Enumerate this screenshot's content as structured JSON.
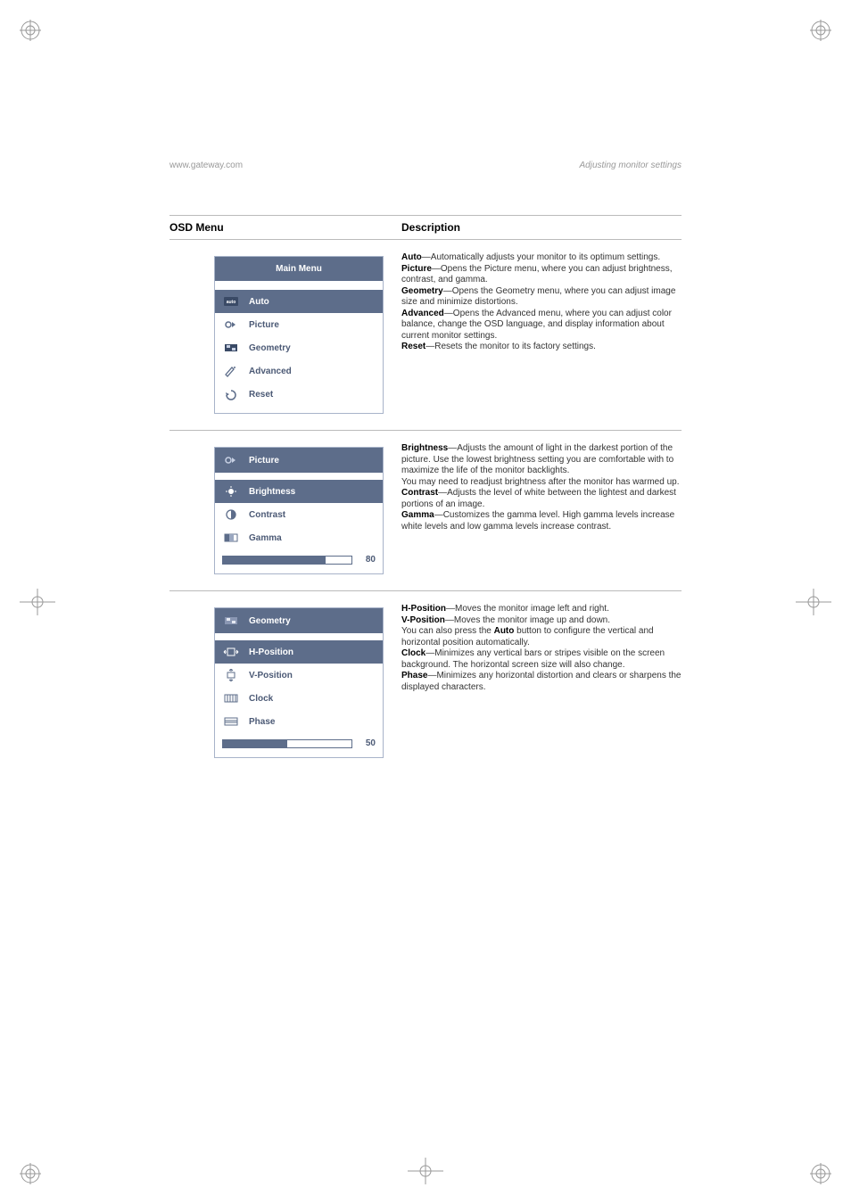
{
  "header": {
    "left": "www.gateway.com",
    "right": "Adjusting monitor settings"
  },
  "table_headers": {
    "osd": "OSD Menu",
    "desc": "Description"
  },
  "main_menu": {
    "title": "Main Menu",
    "items": [
      {
        "label": "Auto",
        "icon": "auto-icon",
        "selected": true
      },
      {
        "label": "Picture",
        "icon": "picture-icon",
        "selected": false
      },
      {
        "label": "Geometry",
        "icon": "geometry-icon",
        "selected": false
      },
      {
        "label": "Advanced",
        "icon": "advanced-icon",
        "selected": false
      },
      {
        "label": "Reset",
        "icon": "reset-icon",
        "selected": false
      }
    ]
  },
  "main_desc": {
    "auto_b": "Auto",
    "auto_t": "—Automatically adjusts your monitor to its optimum settings.",
    "pic_b": "Picture",
    "pic_t": "—Opens the Picture menu, where you can adjust brightness, contrast, and gamma.",
    "geo_b": "Geometry",
    "geo_t": "—Opens the Geometry menu, where you can adjust image size and minimize distortions.",
    "adv_b": "Advanced",
    "adv_t": "—Opens the Advanced menu, where you can adjust color balance, change the OSD language, and display information about current monitor settings.",
    "rst_b": "Reset",
    "rst_t": "—Resets the monitor to its factory settings."
  },
  "picture_menu": {
    "title": "Picture",
    "items": [
      {
        "label": "Brightness",
        "icon": "brightness-icon",
        "selected": true
      },
      {
        "label": "Contrast",
        "icon": "contrast-icon",
        "selected": false
      },
      {
        "label": "Gamma",
        "icon": "gamma-icon",
        "selected": false
      }
    ],
    "slider": {
      "value": "80",
      "pct": 80
    }
  },
  "picture_desc": {
    "b1": "Brightness",
    "t1": "—Adjusts the amount of light in the darkest portion of the picture. Use the lowest brightness setting you are comfortable with to maximize the life of the monitor backlights.",
    "t1b": "You may need to readjust brightness after the monitor has warmed up.",
    "b2": "Contrast",
    "t2": "—Adjusts the level of white between the lightest and darkest portions of an image.",
    "b3": "Gamma",
    "t3": "—Customizes the gamma level. High gamma levels increase white levels and low gamma levels increase contrast."
  },
  "geometry_menu": {
    "title": "Geometry",
    "items": [
      {
        "label": "H-Position",
        "icon": "hpos-icon",
        "selected": true
      },
      {
        "label": "V-Position",
        "icon": "vpos-icon",
        "selected": false
      },
      {
        "label": "Clock",
        "icon": "clock-icon",
        "selected": false
      },
      {
        "label": "Phase",
        "icon": "phase-icon",
        "selected": false
      }
    ],
    "slider": {
      "value": "50",
      "pct": 50
    }
  },
  "geometry_desc": {
    "b1": "H-Position",
    "t1": "—Moves the monitor image left and right.",
    "b2": "V-Position",
    "t2": "—Moves the monitor image up and down.",
    "t2b_a": "You can also press the ",
    "t2b_bold": "Auto",
    "t2b_b": " button to configure the vertical and horizontal position automatically.",
    "b3": "Clock",
    "t3": "—Minimizes any vertical bars or stripes visible on the screen background. The horizontal screen size will also change.",
    "b4": "Phase",
    "t4": "—Minimizes any horizontal distortion and clears or sharpens the displayed characters."
  }
}
